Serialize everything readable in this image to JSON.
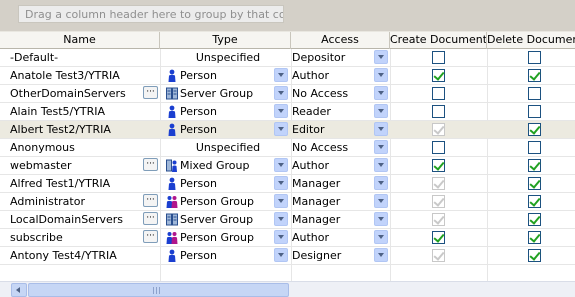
{
  "group_hint": "Drag a column header here to group by that content.",
  "columns": [
    "Name",
    "Type",
    "Access",
    "Create Documents",
    "Delete Documents"
  ],
  "colors": {
    "accent": "#c1d3fb",
    "check": "#21a121",
    "selected_row": "#eceae0"
  },
  "rows": [
    {
      "name": "-Default-",
      "type": "Unspecified",
      "type_icon": "",
      "access": "Depositor",
      "create": false,
      "create_enabled": true,
      "delete": false,
      "delete_enabled": true,
      "dots": false,
      "type_dd": false,
      "selected": false
    },
    {
      "name": "Anatole Test3/YTRIA",
      "type": "Person",
      "type_icon": "person-icon",
      "access": "Author",
      "create": true,
      "create_enabled": true,
      "delete": true,
      "delete_enabled": true,
      "dots": false,
      "type_dd": true,
      "selected": false
    },
    {
      "name": "OtherDomainServers",
      "type": "Server Group",
      "type_icon": "server-group-icon",
      "access": "No Access",
      "create": false,
      "create_enabled": true,
      "delete": false,
      "delete_enabled": true,
      "dots": true,
      "type_dd": true,
      "selected": false
    },
    {
      "name": "Alain Test5/YTRIA",
      "type": "Person",
      "type_icon": "person-icon",
      "access": "Reader",
      "create": false,
      "create_enabled": true,
      "delete": false,
      "delete_enabled": true,
      "dots": false,
      "type_dd": true,
      "selected": false
    },
    {
      "name": "Albert Test2/YTRIA",
      "type": "Person",
      "type_icon": "person-icon",
      "access": "Editor",
      "create": true,
      "create_enabled": false,
      "delete": true,
      "delete_enabled": true,
      "dots": false,
      "type_dd": true,
      "selected": true
    },
    {
      "name": "Anonymous",
      "type": "Unspecified",
      "type_icon": "",
      "access": "No Access",
      "create": false,
      "create_enabled": true,
      "delete": false,
      "delete_enabled": true,
      "dots": false,
      "type_dd": false,
      "selected": false
    },
    {
      "name": "webmaster",
      "type": "Mixed Group",
      "type_icon": "mixed-group-icon",
      "access": "Author",
      "create": true,
      "create_enabled": true,
      "delete": true,
      "delete_enabled": true,
      "dots": true,
      "type_dd": true,
      "selected": false
    },
    {
      "name": "Alfred Test1/YTRIA",
      "type": "Person",
      "type_icon": "person-icon",
      "access": "Manager",
      "create": true,
      "create_enabled": false,
      "delete": true,
      "delete_enabled": true,
      "dots": false,
      "type_dd": true,
      "selected": false
    },
    {
      "name": "Administrator",
      "type": "Person Group",
      "type_icon": "person-group-icon",
      "access": "Manager",
      "create": true,
      "create_enabled": false,
      "delete": true,
      "delete_enabled": true,
      "dots": true,
      "type_dd": true,
      "selected": false
    },
    {
      "name": "LocalDomainServers",
      "type": "Server Group",
      "type_icon": "server-group-icon",
      "access": "Manager",
      "create": true,
      "create_enabled": false,
      "delete": true,
      "delete_enabled": true,
      "dots": true,
      "type_dd": true,
      "selected": false
    },
    {
      "name": "subscribe",
      "type": "Person Group",
      "type_icon": "person-group-icon",
      "access": "Author",
      "create": true,
      "create_enabled": true,
      "delete": true,
      "delete_enabled": true,
      "dots": true,
      "type_dd": true,
      "selected": false
    },
    {
      "name": "Antony Test4/YTRIA",
      "type": "Person",
      "type_icon": "person-icon",
      "access": "Designer",
      "create": true,
      "create_enabled": false,
      "delete": true,
      "delete_enabled": true,
      "dots": false,
      "type_dd": true,
      "selected": false
    }
  ]
}
